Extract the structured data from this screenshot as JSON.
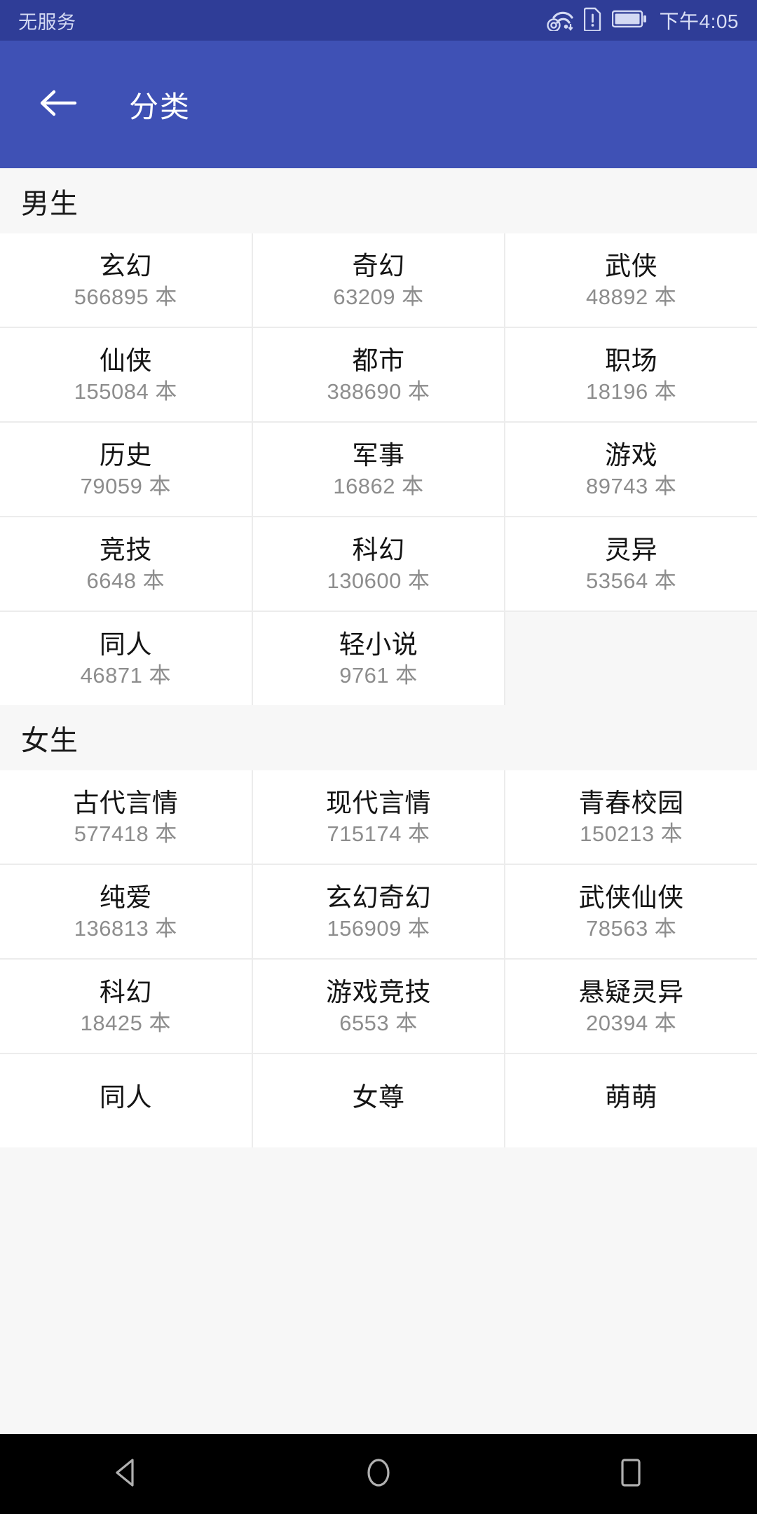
{
  "status_bar": {
    "carrier": "无服务",
    "time": "下午4:05",
    "icons": [
      "wifi-signal-icon",
      "sim-alert-icon",
      "battery-icon"
    ],
    "bg_color": "#2f3d97",
    "text_color": "#d3d9f3"
  },
  "appbar": {
    "back_label": "back-arrow",
    "title": "分类",
    "bg_color": "#3f51b5",
    "text_color": "#ffffff"
  },
  "unit_suffix": "本",
  "sections": [
    {
      "title": "男生",
      "items": [
        {
          "name": "玄幻",
          "count": "566895",
          "count_text": "566895 本"
        },
        {
          "name": "奇幻",
          "count": "63209",
          "count_text": "63209 本"
        },
        {
          "name": "武侠",
          "count": "48892",
          "count_text": "48892 本"
        },
        {
          "name": "仙侠",
          "count": "155084",
          "count_text": "155084 本"
        },
        {
          "name": "都市",
          "count": "388690",
          "count_text": "388690 本"
        },
        {
          "name": "职场",
          "count": "18196",
          "count_text": "18196 本"
        },
        {
          "name": "历史",
          "count": "79059",
          "count_text": "79059 本"
        },
        {
          "name": "军事",
          "count": "16862",
          "count_text": "16862 本"
        },
        {
          "name": "游戏",
          "count": "89743",
          "count_text": "89743 本"
        },
        {
          "name": "竞技",
          "count": "6648",
          "count_text": "6648 本"
        },
        {
          "name": "科幻",
          "count": "130600",
          "count_text": "130600 本"
        },
        {
          "name": "灵异",
          "count": "53564",
          "count_text": "53564 本"
        },
        {
          "name": "同人",
          "count": "46871",
          "count_text": "46871 本"
        },
        {
          "name": "轻小说",
          "count": "9761",
          "count_text": "9761 本"
        }
      ]
    },
    {
      "title": "女生",
      "items": [
        {
          "name": "古代言情",
          "count": "577418",
          "count_text": "577418 本"
        },
        {
          "name": "现代言情",
          "count": "715174",
          "count_text": "715174 本"
        },
        {
          "name": "青春校园",
          "count": "150213",
          "count_text": "150213 本"
        },
        {
          "name": "纯爱",
          "count": "136813",
          "count_text": "136813 本"
        },
        {
          "name": "玄幻奇幻",
          "count": "156909",
          "count_text": "156909 本"
        },
        {
          "name": "武侠仙侠",
          "count": "78563",
          "count_text": "78563 本"
        },
        {
          "name": "科幻",
          "count": "18425",
          "count_text": "18425 本"
        },
        {
          "name": "游戏竞技",
          "count": "6553",
          "count_text": "6553 本"
        },
        {
          "name": "悬疑灵异",
          "count": "20394",
          "count_text": "20394 本"
        },
        {
          "name": "同人",
          "count": "",
          "count_text": ""
        },
        {
          "name": "女尊",
          "count": "",
          "count_text": ""
        },
        {
          "name": "萌萌",
          "count": "",
          "count_text": ""
        }
      ]
    }
  ],
  "nav_bar": {
    "back": "nav-back-icon",
    "home": "nav-home-icon",
    "recents": "nav-recents-icon",
    "bg_color": "#000000",
    "icon_color": "#b0b0b0"
  }
}
